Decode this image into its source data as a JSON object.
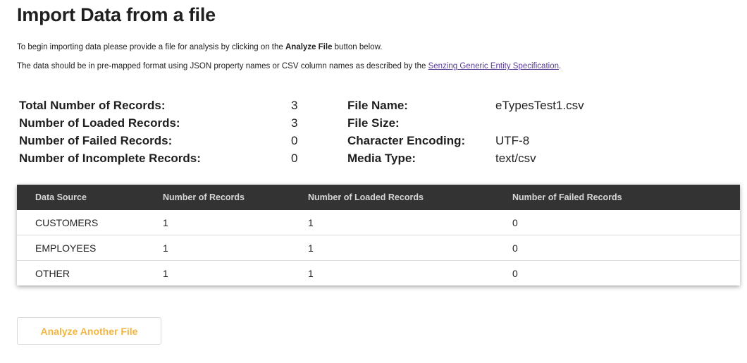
{
  "page": {
    "title": "Import Data from a file",
    "intro_line1": {
      "before": "To begin importing data please provide a file for analysis by clicking on the ",
      "bold": "Analyze File",
      "after": " button below."
    },
    "intro_line2": {
      "before": "The data should be in pre-mapped format using JSON property names or CSV column names as described by the ",
      "link": "Senzing Generic Entity Specification",
      "after": "."
    }
  },
  "stats": [
    {
      "label": "Total Number of Records:",
      "value": "3"
    },
    {
      "label": "Number of Loaded Records:",
      "value": "3"
    },
    {
      "label": "Number of Failed Records:",
      "value": "0"
    },
    {
      "label": "Number of Incomplete Records:",
      "value": "0"
    }
  ],
  "file_info": [
    {
      "label": "File Name:",
      "value": "eTypesTest1.csv"
    },
    {
      "label": "File Size:",
      "value": ""
    },
    {
      "label": "Character Encoding:",
      "value": "UTF-8"
    },
    {
      "label": "Media Type:",
      "value": "text/csv"
    }
  ],
  "table": {
    "headers": [
      "Data Source",
      "Number of Records",
      "Number of Loaded Records",
      "Number of Failed Records"
    ],
    "rows": [
      [
        "CUSTOMERS",
        "1",
        "1",
        "0"
      ],
      [
        "EMPLOYEES",
        "1",
        "1",
        "0"
      ],
      [
        "OTHER",
        "1",
        "1",
        "0"
      ]
    ]
  },
  "actions": {
    "analyze_another_label": "Analyze Another File"
  },
  "colors": {
    "header_bg": "#333333",
    "button_text": "#f3b53f",
    "link": "#5a3b9a"
  }
}
